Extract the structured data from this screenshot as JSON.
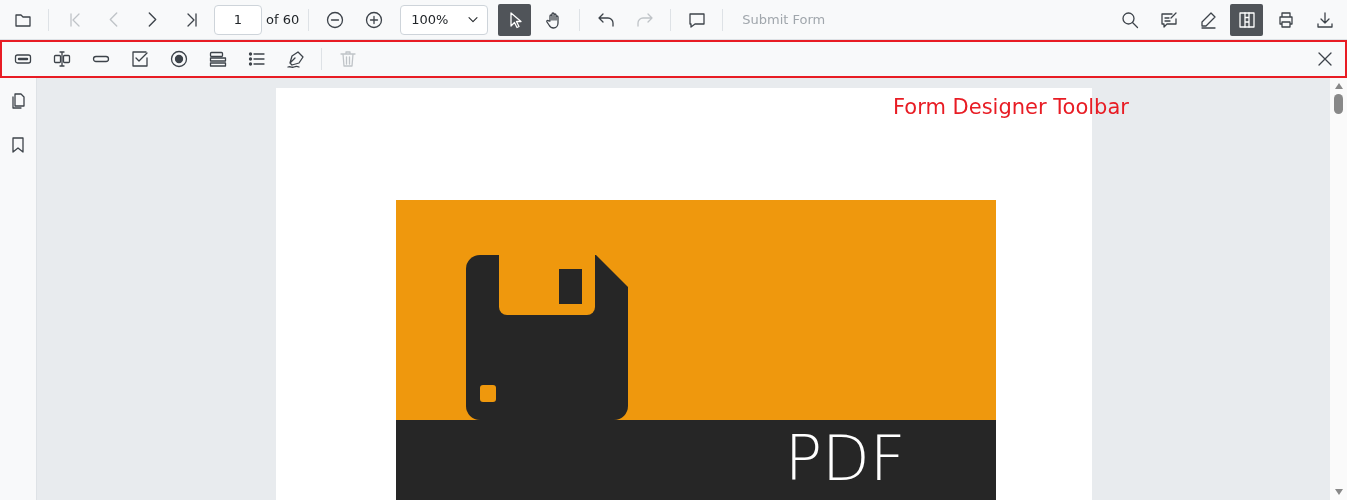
{
  "main_toolbar": {
    "nav_buttons": [
      {
        "disabled": false
      },
      {
        "disabled": true
      },
      {
        "disabled": true
      },
      {
        "disabled": false
      },
      {
        "disabled": false
      }
    ],
    "page_number": "1",
    "page_count": "of 60",
    "zoom_level": "100%",
    "tools": [
      {
        "selected": true
      },
      {
        "selected": false
      }
    ],
    "history": [
      {
        "disabled": false
      },
      {
        "disabled": true
      }
    ],
    "submit_button": {
      "label": "Submit Form",
      "disabled": true
    },
    "right_buttons": [
      {
        "selected": false
      },
      {
        "selected": false
      },
      {
        "selected": false
      },
      {
        "selected": true
      },
      {
        "selected": false
      },
      {
        "selected": false
      }
    ]
  },
  "form_toolbar": {
    "highlighted": true,
    "fields": [
      {
        "disabled": false
      },
      {
        "disabled": false
      },
      {
        "disabled": false
      },
      {
        "disabled": false
      },
      {
        "disabled": false
      },
      {
        "disabled": false
      },
      {
        "disabled": false
      },
      {
        "disabled": false
      },
      {
        "disabled": true
      }
    ]
  },
  "annotation": "Form Designer Toolbar",
  "document": {
    "cover_text": "PDF"
  }
}
